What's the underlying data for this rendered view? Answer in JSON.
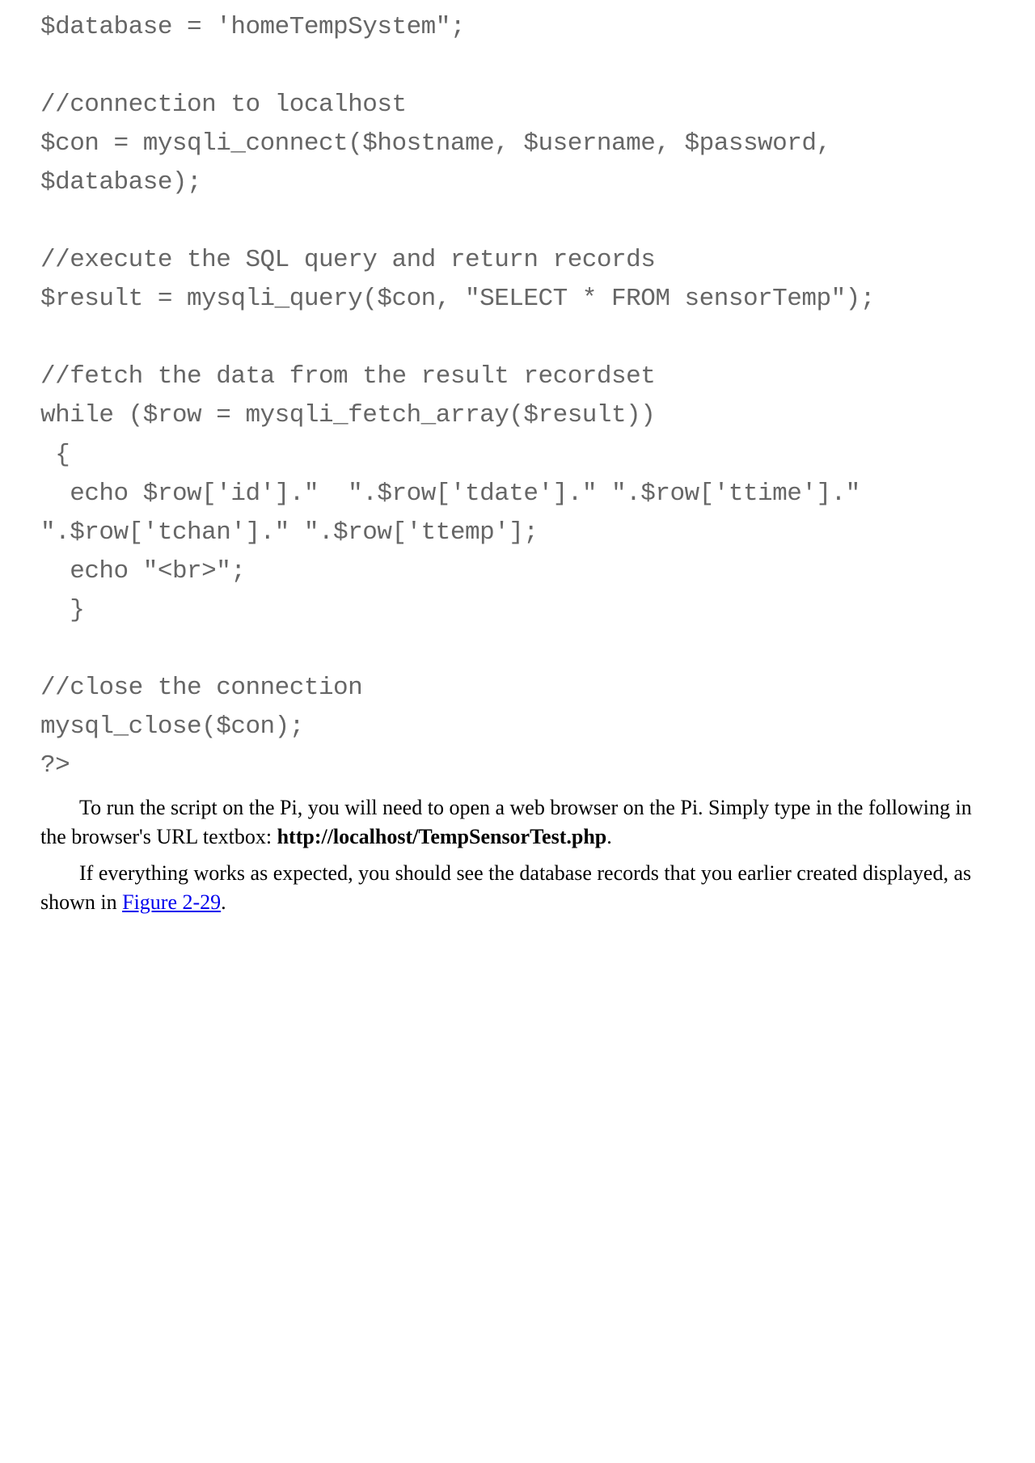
{
  "code": "$database = 'homeTempSystem\";\n\n//connection to localhost\n$con = mysqli_connect($hostname, $username, $password, $database);\n\n//execute the SQL query and return records\n$result = mysqli_query($con, \"SELECT * FROM sensorTemp\");\n\n//fetch the data from the result recordset\nwhile ($row = mysqli_fetch_array($result))\n {\n  echo $row['id'].\"  \".$row['tdate'].\" \".$row['ttime'].\" \".$row['tchan'].\" \".$row['ttemp'];\n  echo \"<br>\";\n  }\n\n//close the connection\nmysql_close($con);\n?>",
  "para1_a": "To run the script on the Pi, you will need to open a web browser on the Pi. Simply type in the following in the browser's URL textbox: ",
  "para1_b": "http://localhost/TempSensorTest.php",
  "para1_c": ".",
  "para2_a": "If everything works as expected, you should see the database records that you earlier created displayed, as shown in ",
  "figlink": "Figure 2-29",
  "para2_c": "."
}
